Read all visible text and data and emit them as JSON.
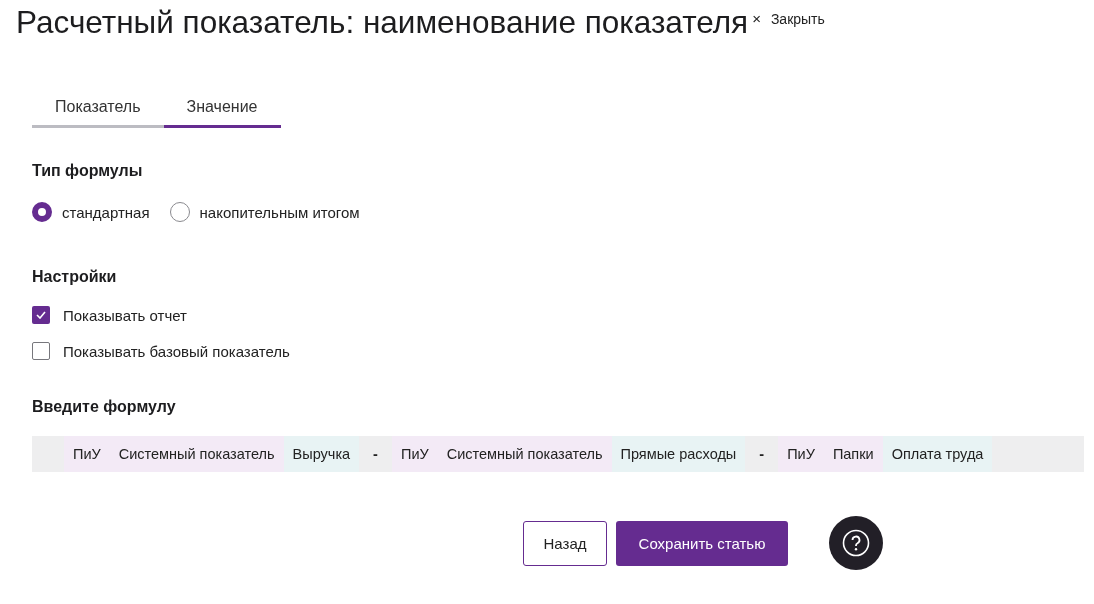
{
  "header": {
    "title": "Расчетный показатель: наименование показателя",
    "close_icon": "×",
    "close_label": "Закрыть"
  },
  "tabs": [
    {
      "label": "Показатель",
      "selected": false
    },
    {
      "label": "Значение",
      "selected": true
    }
  ],
  "formula_type": {
    "heading": "Тип формулы",
    "options": [
      {
        "label": "стандартная",
        "selected": true
      },
      {
        "label": "накопительным итогом",
        "selected": false
      }
    ]
  },
  "settings": {
    "heading": "Настройки",
    "options": [
      {
        "label": "Показывать отчет",
        "checked": true
      },
      {
        "label": "Показывать базовый показатель",
        "checked": false
      }
    ]
  },
  "formula": {
    "heading": "Введите формулу",
    "tokens": [
      {
        "kind": "source",
        "text": "ПиУ"
      },
      {
        "kind": "source",
        "text": "Системный показатель"
      },
      {
        "kind": "item",
        "text": "Выручка"
      },
      {
        "kind": "operator",
        "text": "-"
      },
      {
        "kind": "source",
        "text": "ПиУ"
      },
      {
        "kind": "source",
        "text": "Системный показатель"
      },
      {
        "kind": "item",
        "text": "Прямые расходы"
      },
      {
        "kind": "operator",
        "text": "-"
      },
      {
        "kind": "source",
        "text": "ПиУ"
      },
      {
        "kind": "source",
        "text": "Папки"
      },
      {
        "kind": "item",
        "text": "Оплата труда"
      }
    ]
  },
  "buttons": {
    "back": "Назад",
    "save": "Сохранить статью"
  }
}
